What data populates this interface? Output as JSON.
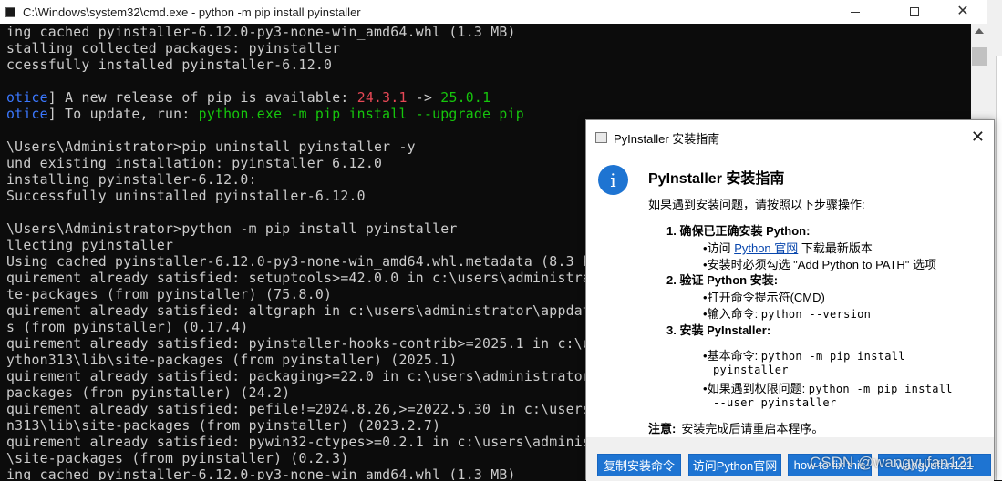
{
  "window": {
    "title": "C:\\Windows\\system32\\cmd.exe - python  -m pip install pyinstaller",
    "minimize": "—",
    "maximize": "☐",
    "close": "✕"
  },
  "console": {
    "lines": [
      "ing cached pyinstaller-6.12.0-py3-none-win_amd64.whl (1.3 MB)",
      "stalling collected packages: pyinstaller",
      "ccessfully installed pyinstaller-6.12.0",
      "",
      "",
      "",
      "\\Users\\Administrator>pip uninstall pyinstaller -y",
      "und existing installation: pyinstaller 6.12.0",
      "installing pyinstaller-6.12.0:",
      "Successfully uninstalled pyinstaller-6.12.0",
      "",
      "\\Users\\Administrator>python -m pip install pyinstaller",
      "llecting pyinstaller",
      "Using cached pyinstaller-6.12.0-py3-none-win_amd64.whl.metadata (8.3 kB)",
      "quirement already satisfied: setuptools>=42.0.0 in c:\\users\\administrat",
      "te-packages (from pyinstaller) (75.8.0)",
      "quirement already satisfied: altgraph in c:\\users\\administrator\\appdata",
      "s (from pyinstaller) (0.17.4)",
      "quirement already satisfied: pyinstaller-hooks-contrib>=2025.1 in c:\\us",
      "ython313\\lib\\site-packages (from pyinstaller) (2025.1)",
      "quirement already satisfied: packaging>=22.0 in c:\\users\\administrator\\",
      "packages (from pyinstaller) (24.2)",
      "quirement already satisfied: pefile!=2024.8.26,>=2022.5.30 in c:\\users\\",
      "n313\\lib\\site-packages (from pyinstaller) (2023.2.7)",
      "quirement already satisfied: pywin32-ctypes>=0.2.1 in c:\\users\\administ",
      "\\site-packages (from pyinstaller) (0.2.3)",
      "ing cached pyinstaller-6.12.0-py3-none-win_amd64.whl (1.3 MB)"
    ],
    "notice1": {
      "tag": "otice",
      "bracket": "]",
      "text": " A new release of pip is available: ",
      "old_version": "24.3.1",
      "arrow": " -> ",
      "new_version": "25.0.1"
    },
    "notice2": {
      "tag": "otice",
      "bracket": "]",
      "text": " To update, run: ",
      "command": "python.exe -m pip install --upgrade pip"
    },
    "colors": {
      "notice": "#3b78ff",
      "old": "#e74856",
      "new": "#16c60c",
      "text": "#cccccc"
    }
  },
  "dialog": {
    "title": "PyInstaller 安装指南",
    "close": "✕",
    "icon": "info-icon",
    "heading": "PyInstaller 安装指南",
    "intro": "如果遇到安装问题，请按照以下步骤操作:",
    "step1": "1. 确保已正确安装 Python:",
    "step1_b1_pre": "访问 ",
    "step1_b1_link": "Python 官网",
    "step1_b1_post": " 下载最新版本",
    "step1_b2": "安装时必须勾选 \"Add Python to PATH\" 选项",
    "step2": "2. 验证 Python 安装:",
    "step2_b1": "打开命令提示符(CMD)",
    "step2_b2_pre": "输入命令: ",
    "step2_b2_code": "python --version",
    "step3": "3. 安装 PyInstaller:",
    "step3_b1_pre": "基本命令: ",
    "step3_b1_code": "python -m pip install",
    "step3_b1_cont": "pyinstaller",
    "step3_b2_pre": "如果遇到权限问题: ",
    "step3_b2_code": "python -m pip install",
    "step3_b2_cont": "--user pyinstaller",
    "bullet": "•",
    "note_label": "注意:",
    "note_text": "安装完成后请重启本程序。",
    "buttons": [
      "复制安装命令",
      "访问Python官网",
      "how to fix this",
      "wangyufan121"
    ],
    "accent": "#1e74d2"
  },
  "watermark": "CSDN @wangyufan121"
}
